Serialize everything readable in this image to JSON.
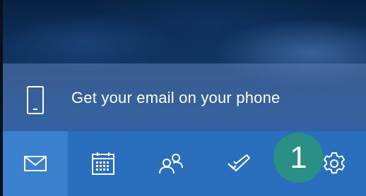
{
  "promo": {
    "text": "Get your email on your phone",
    "icon": "phone-icon"
  },
  "nav": {
    "items": [
      {
        "name": "mail",
        "icon": "mail-icon",
        "active": true
      },
      {
        "name": "calendar",
        "icon": "calendar-icon",
        "active": false
      },
      {
        "name": "people",
        "icon": "people-icon",
        "active": false
      },
      {
        "name": "todo",
        "icon": "checkmark-icon",
        "active": false
      },
      {
        "name": "settings",
        "icon": "gear-icon",
        "active": false
      }
    ]
  },
  "callout": {
    "number": "1",
    "color": "#2a8f85"
  },
  "colors": {
    "nav_bar": "#2a6fbd",
    "nav_active": "#3b80cc",
    "promo_band": "#5a7daf",
    "text": "#ffffff"
  }
}
